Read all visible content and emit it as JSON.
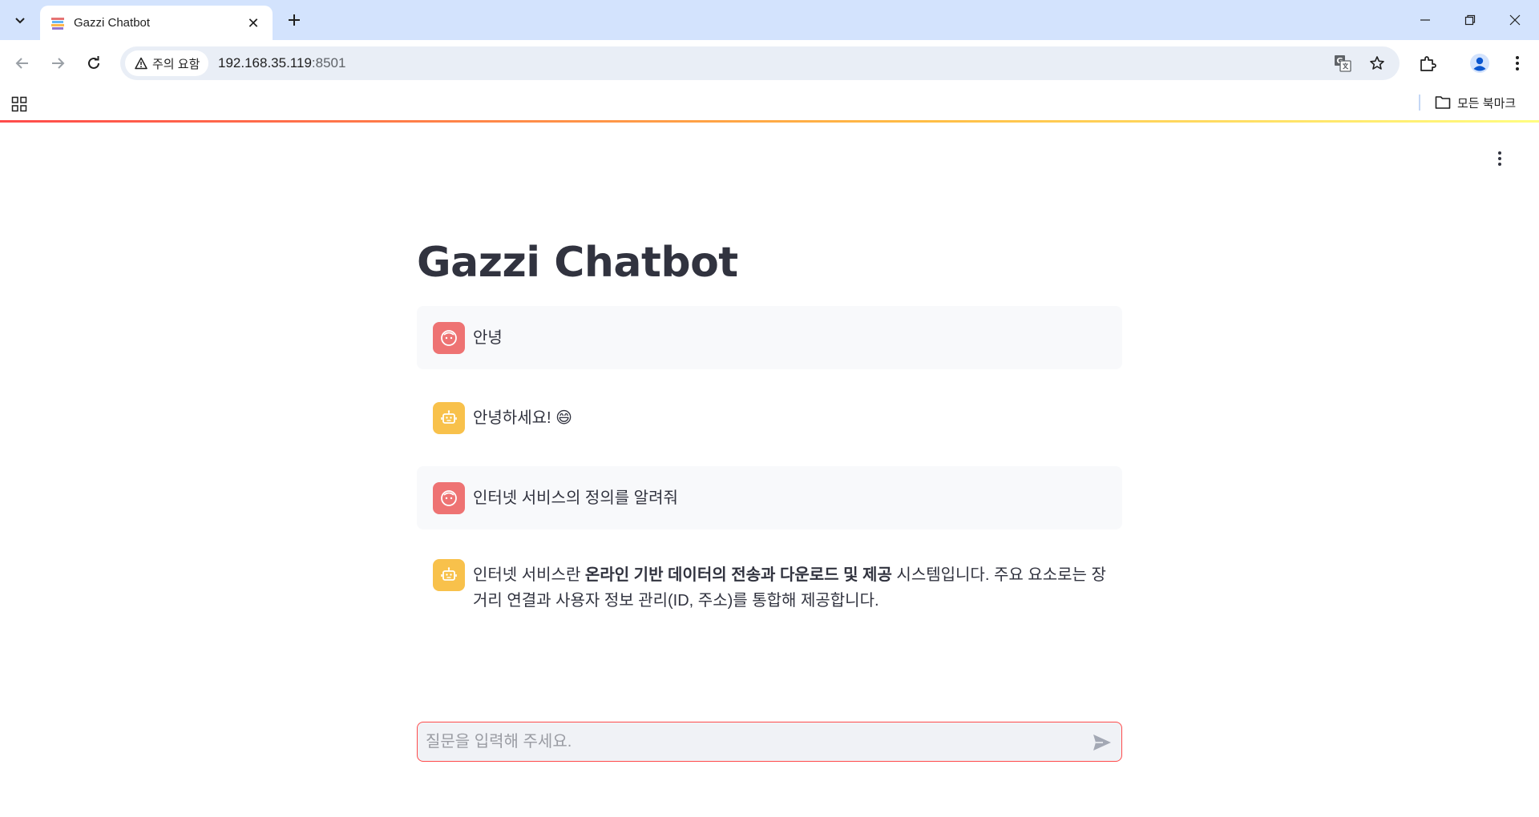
{
  "browser": {
    "tab_title": "Gazzi Chatbot",
    "security_label": "주의 요함",
    "url_host": "192.168.35.119",
    "url_port": ":8501",
    "bookmarks_all_label": "모든 북마크"
  },
  "app": {
    "title": "Gazzi Chatbot",
    "colors": {
      "accent": "#ff4b4b",
      "user_avatar": "#ee7373",
      "bot_avatar": "#f8c14b",
      "text": "#31333f"
    },
    "messages": [
      {
        "role": "user",
        "text": "안녕"
      },
      {
        "role": "assistant",
        "text": "안녕하세요! 😄"
      },
      {
        "role": "user",
        "text": "인터넷 서비스의 정의를 알려줘"
      },
      {
        "role": "assistant",
        "text_prefix": "인터넷 서비스란 ",
        "text_bold": "온라인 기반 데이터의 전송과 다운로드 및 제공",
        "text_suffix": " 시스템입니다. 주요 요소로는 장거리 연결과 사용자 정보 관리(ID, 주소)를 통합해 제공합니다."
      }
    ],
    "chat_input": {
      "placeholder": "질문을 입력해 주세요.",
      "value": ""
    }
  },
  "icons": {
    "tab_search": "chevron-down-icon",
    "new_tab": "plus-icon",
    "translate": "translate-icon",
    "bookmark_star": "star-icon",
    "extensions": "puzzle-icon",
    "profile": "person-icon",
    "menu": "kebab-menu-icon",
    "send": "send-icon"
  }
}
